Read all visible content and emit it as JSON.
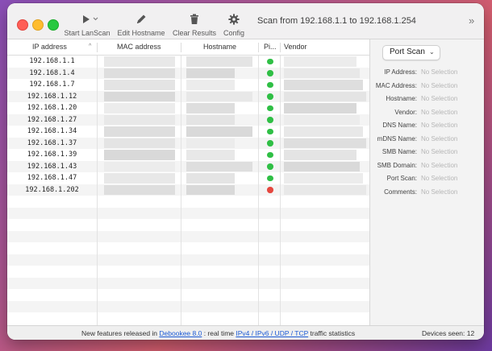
{
  "window": {
    "title": "Scan from 192.168.1.1 to 192.168.1.254"
  },
  "toolbar": {
    "start_label": "Start LanScan",
    "edit_label": "Edit Hostname",
    "clear_label": "Clear Results",
    "config_label": "Config"
  },
  "table": {
    "headers": {
      "ip": "IP address",
      "mac": "MAC address",
      "hostname": "Hostname",
      "ping": "Pi...",
      "vendor": "Vendor"
    },
    "rows": [
      {
        "ip": "192.168.1.1",
        "status": "online"
      },
      {
        "ip": "192.168.1.4",
        "status": "online"
      },
      {
        "ip": "192.168.1.7",
        "status": "online"
      },
      {
        "ip": "192.168.1.12",
        "status": "online"
      },
      {
        "ip": "192.168.1.20",
        "status": "online"
      },
      {
        "ip": "192.168.1.27",
        "status": "online"
      },
      {
        "ip": "192.168.1.34",
        "status": "online"
      },
      {
        "ip": "192.168.1.37",
        "status": "online"
      },
      {
        "ip": "192.168.1.39",
        "status": "online"
      },
      {
        "ip": "192.168.1.43",
        "status": "online"
      },
      {
        "ip": "192.168.1.47",
        "status": "online"
      },
      {
        "ip": "192.168.1.202",
        "status": "offline"
      }
    ]
  },
  "sidebar": {
    "popup_label": "Port Scan",
    "fields": [
      {
        "label": "IP Address:",
        "value": "No Selection"
      },
      {
        "label": "MAC Address:",
        "value": "No Selection"
      },
      {
        "label": "Hostname:",
        "value": "No Selection"
      },
      {
        "label": "Vendor:",
        "value": "No Selection"
      },
      {
        "label": "DNS Name:",
        "value": "No Selection"
      },
      {
        "label": "mDNS Name:",
        "value": "No Selection"
      },
      {
        "label": "SMB Name:",
        "value": "No Selection"
      },
      {
        "label": "SMB Domain:",
        "value": "No Selection"
      },
      {
        "label": "Port Scan:",
        "value": "No Selection"
      },
      {
        "label": "Comments:",
        "value": "No Selection"
      }
    ]
  },
  "statusbar": {
    "prefix": "New features released in ",
    "link1": "Debookee 8.0",
    "middle": " : real time ",
    "link2": "IPv4 / IPv6 / UDP / TCP",
    "suffix": " traffic statistics",
    "devices_seen": "Devices seen: 12"
  },
  "colors": {
    "online": "#2fbf45",
    "offline": "#e5473f",
    "link": "#1d5bd6"
  },
  "icons": {
    "start": "play-icon",
    "edit": "pencil-icon",
    "clear": "trash-icon",
    "config": "gear-icon",
    "more": "chevron-double-right-icon"
  }
}
